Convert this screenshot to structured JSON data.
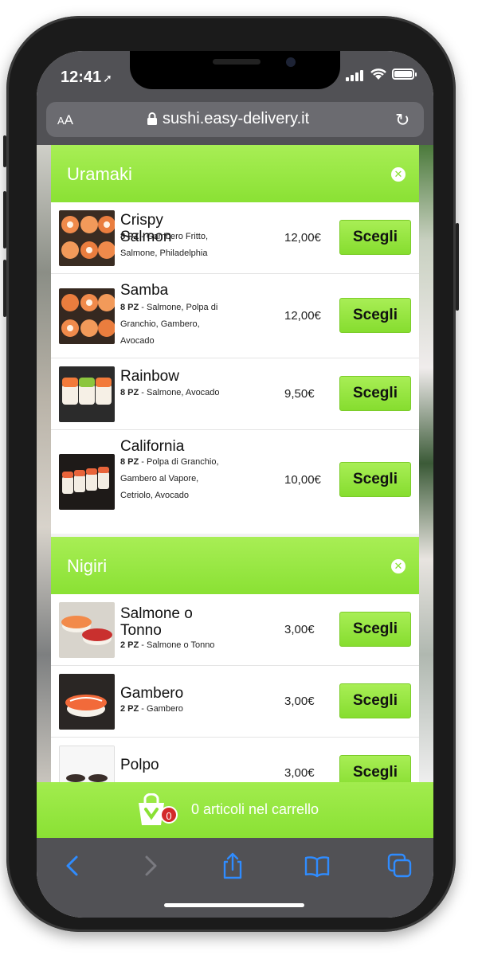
{
  "status": {
    "time": "12:41"
  },
  "browser": {
    "text_size": "AA",
    "url": "sushi.easy-delivery.it"
  },
  "categories": [
    {
      "title": "Uramaki",
      "items": [
        {
          "name": "Crispy Salmon",
          "qty": "8 PZ",
          "desc": " - Gambero Fritto, Salmone, Philadelphia",
          "price": "12,00€",
          "button": "Scegli"
        },
        {
          "name": "Samba",
          "qty": "8 PZ",
          "desc": " - Salmone, Polpa di Granchio, Gambero, Avocado",
          "price": "12,00€",
          "button": "Scegli"
        },
        {
          "name": "Rainbow",
          "qty": "8 PZ",
          "desc": " - Salmone, Avocado",
          "price": "9,50€",
          "button": "Scegli"
        },
        {
          "name": "California",
          "qty": "8 PZ",
          "desc": " - Polpa di Granchio, Gambero al Vapore, Cetriolo, Avocado",
          "price": "10,00€",
          "button": "Scegli"
        }
      ]
    },
    {
      "title": "Nigiri",
      "items": [
        {
          "name": "Salmone o Tonno",
          "qty": "2 PZ",
          "desc": " - Salmone o Tonno",
          "price": "3,00€",
          "button": "Scegli"
        },
        {
          "name": "Gambero",
          "qty": "2 PZ",
          "desc": " - Gambero",
          "price": "3,00€",
          "button": "Scegli"
        },
        {
          "name": "Polpo",
          "qty": "",
          "desc": "",
          "price": "3,00€",
          "button": "Scegli"
        }
      ]
    }
  ],
  "cart": {
    "count": "0",
    "label": "0 articoli nel carrello"
  },
  "colors": {
    "accent": "#8ae134",
    "badge": "#d32a2a",
    "browser_chrome": "#515155",
    "toolbar_icons": "#2f8cff"
  },
  "toolbar": {
    "icons": [
      "back-icon",
      "forward-icon",
      "share-icon",
      "bookmarks-icon",
      "tabs-icon"
    ]
  }
}
